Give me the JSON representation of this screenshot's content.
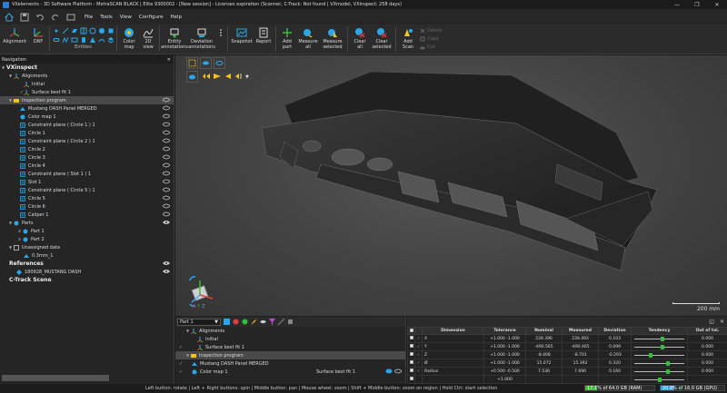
{
  "window": {
    "title": "VXelements - 3D Software Platform - MetraSCAN BLACK | Elite 9300002 - [New session] - Licenses expiration (Scanner, C-Track: Not found | VXmodel, VXinspect: 258 days)",
    "controls": [
      "—",
      "❐",
      "✕"
    ]
  },
  "menu": [
    "File",
    "Tools",
    "View",
    "Configure",
    "Help"
  ],
  "ribbon": {
    "alignment": "Alignment",
    "drf": "DRF",
    "entities_label": "Entities",
    "color_map": "Color\nmap",
    "view_2d": "2D\nview",
    "entity_annotations": "Entity\nannotations",
    "deviation_annotations": "Deviation\nannotations",
    "snapshot": "Snapshot",
    "report": "Report",
    "add_part": "Add\npart",
    "measure_all": "Measure\nall",
    "measure_selected": "Measure\nselected",
    "clear_all": "Clear\nall",
    "clear_selected": "Clear\nselected",
    "add_scan": "Add\nScan",
    "delete": "Delete",
    "copy": "Copy",
    "cut": "Cut"
  },
  "navigation": {
    "header": "Navigation",
    "module": "VXinspect",
    "alignments": "Alignments",
    "alignment_items": [
      "Initial",
      "Surface best fit 1"
    ],
    "inspection_program": "Inspection program",
    "inspection_items": [
      "Mustang DASH Panel MERGED",
      "Color map 1",
      "Constraint plane ( Circle 1 ) 1",
      "Circle 1",
      "Constraint plane ( Circle 2 ) 1",
      "Circle 2",
      "Circle 3",
      "Circle 4",
      "Constraint plane ( Slot 1 ) 1",
      "Slot 1",
      "Constraint plane ( Circle 5 ) 1",
      "Circle 5",
      "Circle 6",
      "Caliper 1"
    ],
    "parts": "Parts",
    "part_items": [
      "Part 1",
      "Part 2"
    ],
    "unassigned": "Unassigned data",
    "unassigned_items": [
      "0.3mm_1"
    ],
    "references": "References",
    "reference_items": [
      "180928_MUSTANG DASH"
    ],
    "ctrack": "C-Track Scene"
  },
  "viewport": {
    "scale": "200 mm",
    "colors": {
      "part": "#2a2a2a",
      "background": "#4a4a4a"
    }
  },
  "bottom_left": {
    "part_select": "Part 1",
    "alignments": "Alignments",
    "alignment_items": [
      "Initial",
      "Surface best fit 1"
    ],
    "inspection_program": "Inspection program",
    "items": [
      "Mustang DASH Panel MERGED",
      "Color map 1"
    ],
    "reference": "Surface best fit 1"
  },
  "dimensions": {
    "headers": [
      "Dimension",
      "Tolerance",
      "Nominal",
      "Measured",
      "Deviation",
      "Tendency",
      "Out of tol."
    ],
    "rows": [
      {
        "name": "X",
        "tolerance": "+1.000 -1.000",
        "nominal": "239.390",
        "measured": "239.493",
        "deviation": "0.103",
        "tendency": 0.55,
        "out_of_tol": "0.000"
      },
      {
        "name": "Y",
        "tolerance": "+1.000 -1.000",
        "nominal": "-490.565",
        "measured": "-490.465",
        "deviation": "0.099",
        "tendency": 0.55,
        "out_of_tol": "0.000"
      },
      {
        "name": "Z",
        "tolerance": "+1.000 -1.000",
        "nominal": "-8.408",
        "measured": "-8.701",
        "deviation": "-0.293",
        "tendency": 0.35,
        "out_of_tol": "0.000"
      },
      {
        "name": "Ø",
        "tolerance": "+1.000 -1.000",
        "nominal": "15.072",
        "measured": "15.392",
        "deviation": "0.320",
        "tendency": 0.66,
        "out_of_tol": "0.000"
      },
      {
        "name": "Radius",
        "tolerance": "+0.500 -0.500",
        "nominal": "7.536",
        "measured": "7.696",
        "deviation": "0.160",
        "tendency": 0.66,
        "out_of_tol": "0.000"
      },
      {
        "name": "",
        "tolerance": "+1.000",
        "nominal": "",
        "measured": "",
        "deviation": "",
        "tendency": 0.5,
        "out_of_tol": ""
      }
    ]
  },
  "status": {
    "hint": "Left button: rotate | Left + Right buttons: spin | Middle button: pan | Mouse wheel: zoom | Shift + Middle button: zoom on region | Hold Ctrl: start selection",
    "ram": "17.1% of 64.0 GB (RAM)",
    "ram_fraction": 0.171,
    "gpu": "20.8% of 16.0 GB (GPU)",
    "gpu_fraction": 0.208
  }
}
